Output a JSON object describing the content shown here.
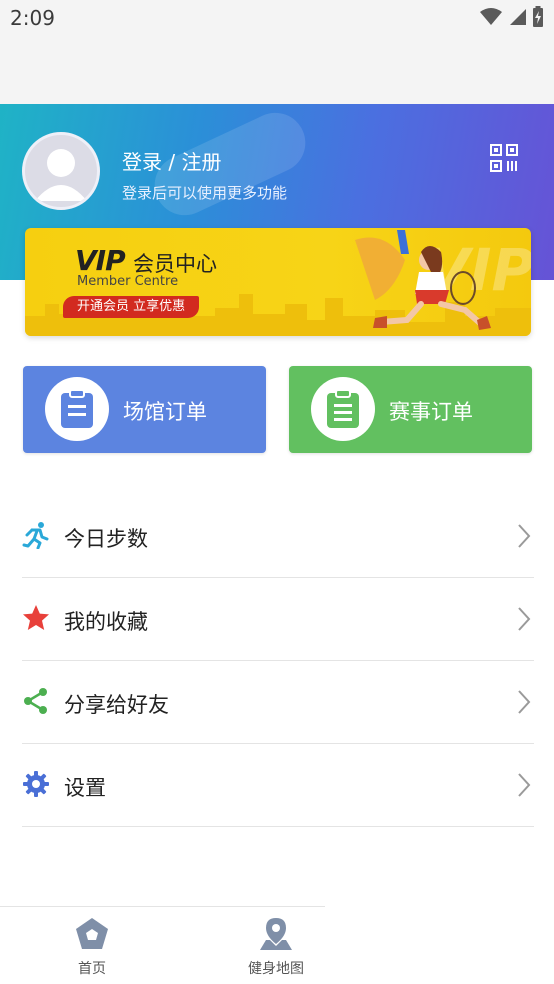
{
  "status_bar": {
    "time": "2:09"
  },
  "header": {
    "login_title": "登录 / 注册",
    "login_subtitle": "登录后可以使用更多功能"
  },
  "vip": {
    "logo": "VIP",
    "title": "会员中心",
    "subtitle": "Member Centre",
    "cta": "开通会员 立享优惠",
    "bg_text": "VIP"
  },
  "orders": {
    "venue_label": "场馆订单",
    "match_label": "赛事订单"
  },
  "menu": {
    "items": [
      {
        "label": "今日步数",
        "icon": "running-person-icon"
      },
      {
        "label": "我的收藏",
        "icon": "star-icon"
      },
      {
        "label": "分享给好友",
        "icon": "share-icon"
      },
      {
        "label": "设置",
        "icon": "gear-icon"
      }
    ]
  },
  "bottom_nav": {
    "home_label": "首页",
    "map_label": "健身地图"
  },
  "colors": {
    "venue_card": "#5c84e0",
    "match_card": "#62c060",
    "star": "#e8403a",
    "share": "#4caf50",
    "gear": "#4a6fd6",
    "runner": "#2aa8d8",
    "vip_cta": "#d22a1f"
  }
}
